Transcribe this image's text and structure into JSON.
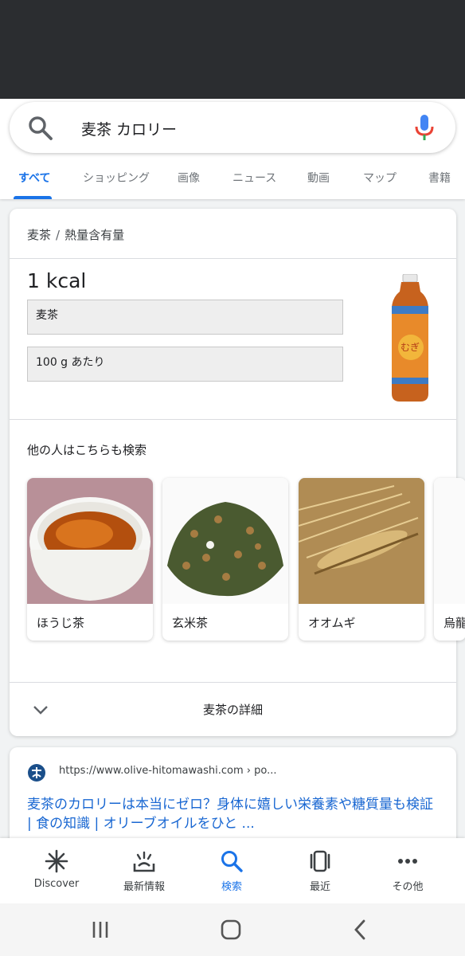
{
  "search": {
    "query": "麦茶 カロリー"
  },
  "tabs": [
    {
      "label": "すべて",
      "active": true
    },
    {
      "label": "ショッピング"
    },
    {
      "label": "画像"
    },
    {
      "label": "ニュース"
    },
    {
      "label": "動画"
    },
    {
      "label": "マップ"
    },
    {
      "label": "書籍"
    }
  ],
  "nutrition": {
    "breadcrumb_item": "麦茶",
    "breadcrumb_sep": "/",
    "breadcrumb_current": "熱量含有量",
    "value": "1 kcal",
    "food_select": "麦茶",
    "amount_select": "100 g あたり",
    "image": "barley-tea-bottle"
  },
  "also_searched": {
    "title": "他の人はこちらも検索",
    "items": [
      {
        "label": "ほうじ茶",
        "image": "hojicha-cup"
      },
      {
        "label": "玄米茶",
        "image": "genmaicha-leaves"
      },
      {
        "label": "オオムギ",
        "image": "barley-ears"
      },
      {
        "label": "烏龍",
        "image": "oolong"
      }
    ]
  },
  "details": {
    "label": "麦茶の詳細",
    "icon": "chevron-down-icon"
  },
  "result": {
    "url": "https://www.olive-hitomawashi.com › po...",
    "title": "麦茶のカロリーは本当にゼロ？身体に嬉しい栄養素や糖質量も検証 | 食の知識 | オリーブオイルをひと ..."
  },
  "bottom_nav": [
    {
      "label": "Discover",
      "icon": "asterisk-icon"
    },
    {
      "label": "最新情報",
      "icon": "updates-icon"
    },
    {
      "label": "検索",
      "icon": "search-icon",
      "active": true
    },
    {
      "label": "最近",
      "icon": "recent-tabs-icon"
    },
    {
      "label": "その他",
      "icon": "more-icon"
    }
  ],
  "colors": {
    "accent": "#1a73e8",
    "link": "#1967d2",
    "status_bar": "#2b2d30"
  }
}
